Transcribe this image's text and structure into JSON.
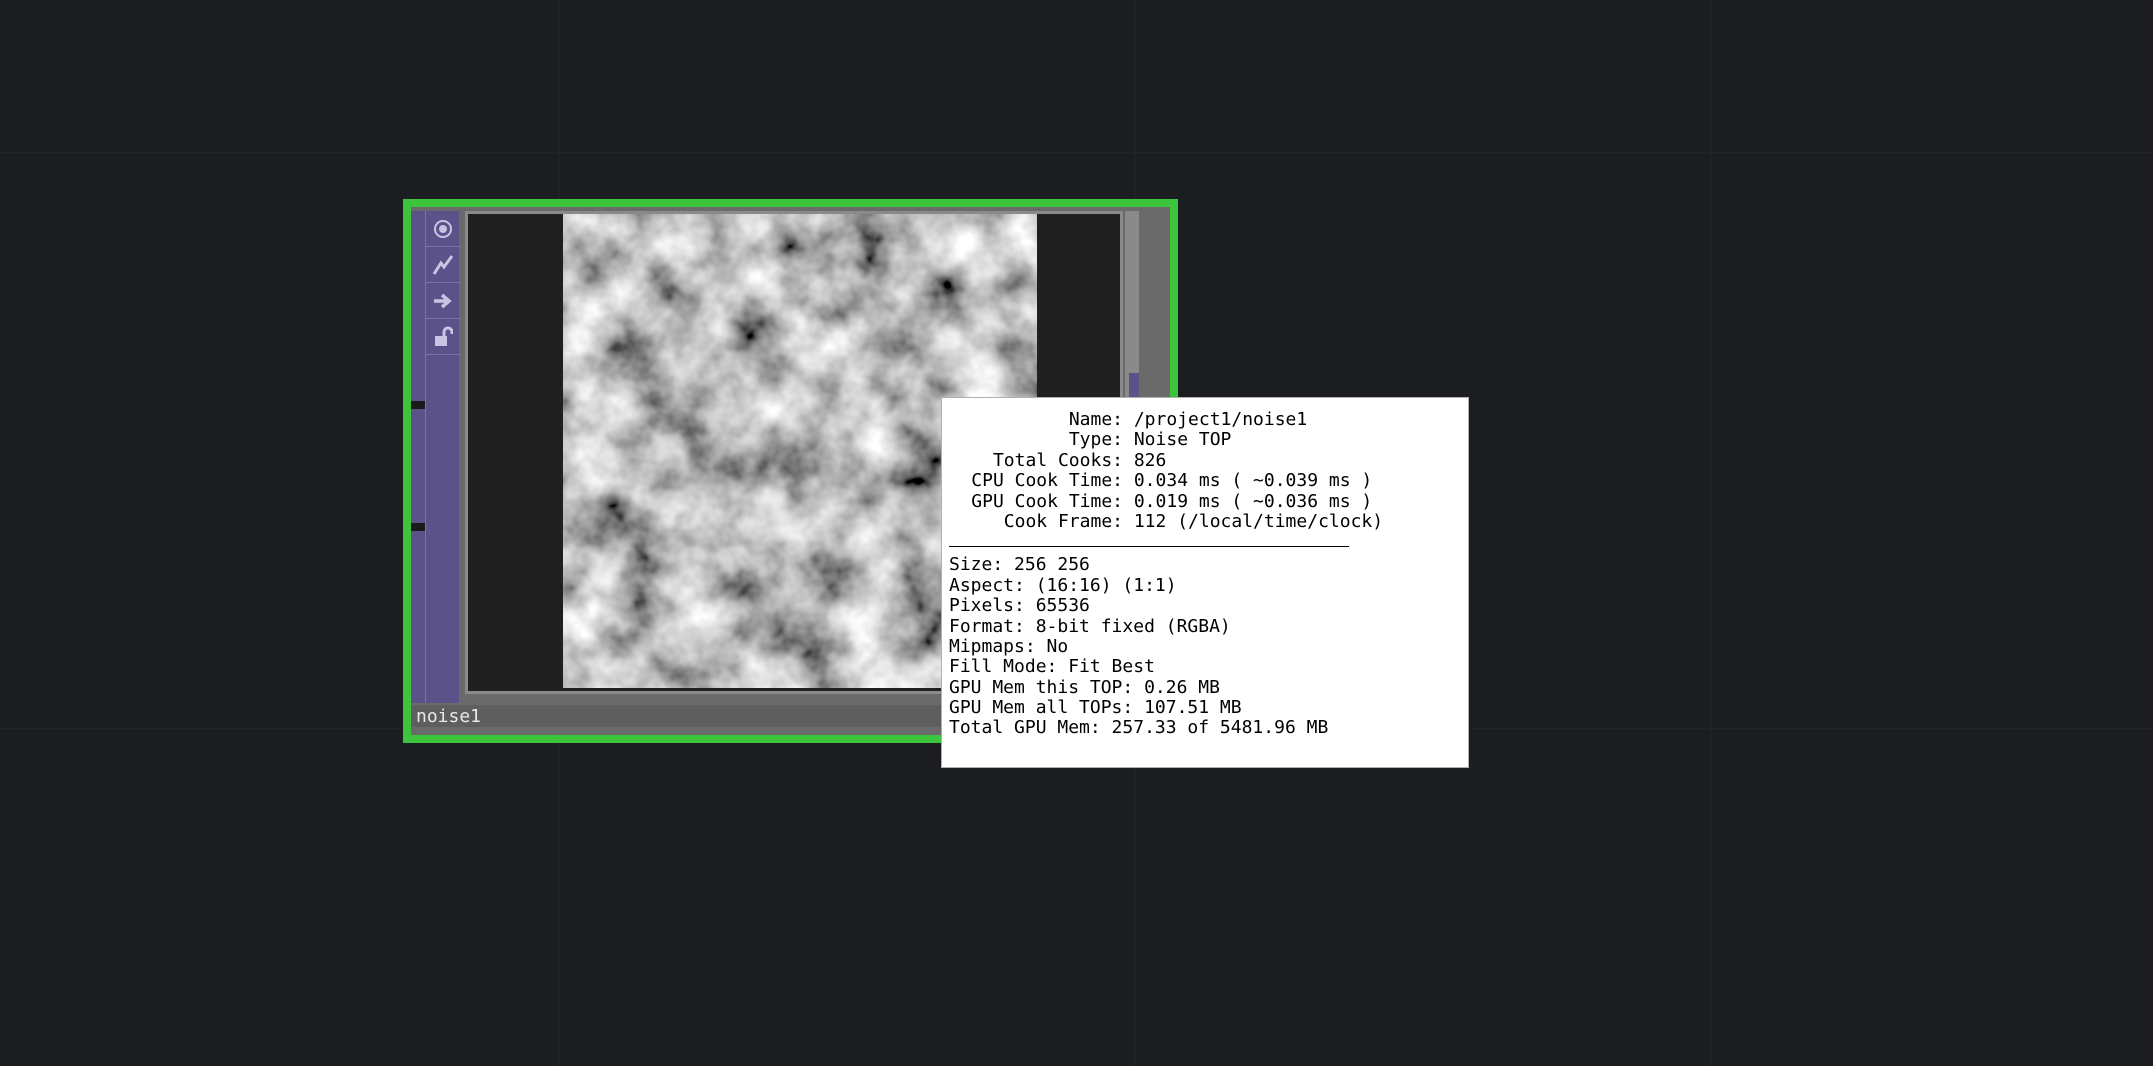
{
  "node": {
    "label": "noise1",
    "toolbar_icons": [
      "viewer-active-icon",
      "bypass-icon",
      "display-flag-icon",
      "lock-icon"
    ]
  },
  "info": {
    "header_rows": [
      {
        "key": "Name:",
        "value": "/project1/noise1"
      },
      {
        "key": "Type:",
        "value": "Noise TOP"
      },
      {
        "key": "Total Cooks:",
        "value": "826"
      },
      {
        "key": "CPU Cook Time:",
        "value": "0.034 ms ( ~0.039 ms )"
      },
      {
        "key": "GPU Cook Time:",
        "value": "0.019 ms ( ~0.036 ms )"
      },
      {
        "key": "Cook Frame:",
        "value": "112 (/local/time/clock)"
      }
    ],
    "detail_rows": [
      "Size: 256 256",
      "Aspect: (16:16) (1:1)",
      "Pixels: 65536",
      "Format: 8-bit fixed (RGBA)",
      "Mipmaps: No",
      "Fill Mode: Fit Best",
      "GPU Mem this TOP: 0.26 MB",
      "GPU Mem all TOPs: 107.51 MB",
      "Total GPU Mem: 257.33 of 5481.96 MB"
    ]
  },
  "colors": {
    "background": "#1c1d20",
    "node_border": "#3cc43c",
    "toolbar": "#5a5288"
  }
}
